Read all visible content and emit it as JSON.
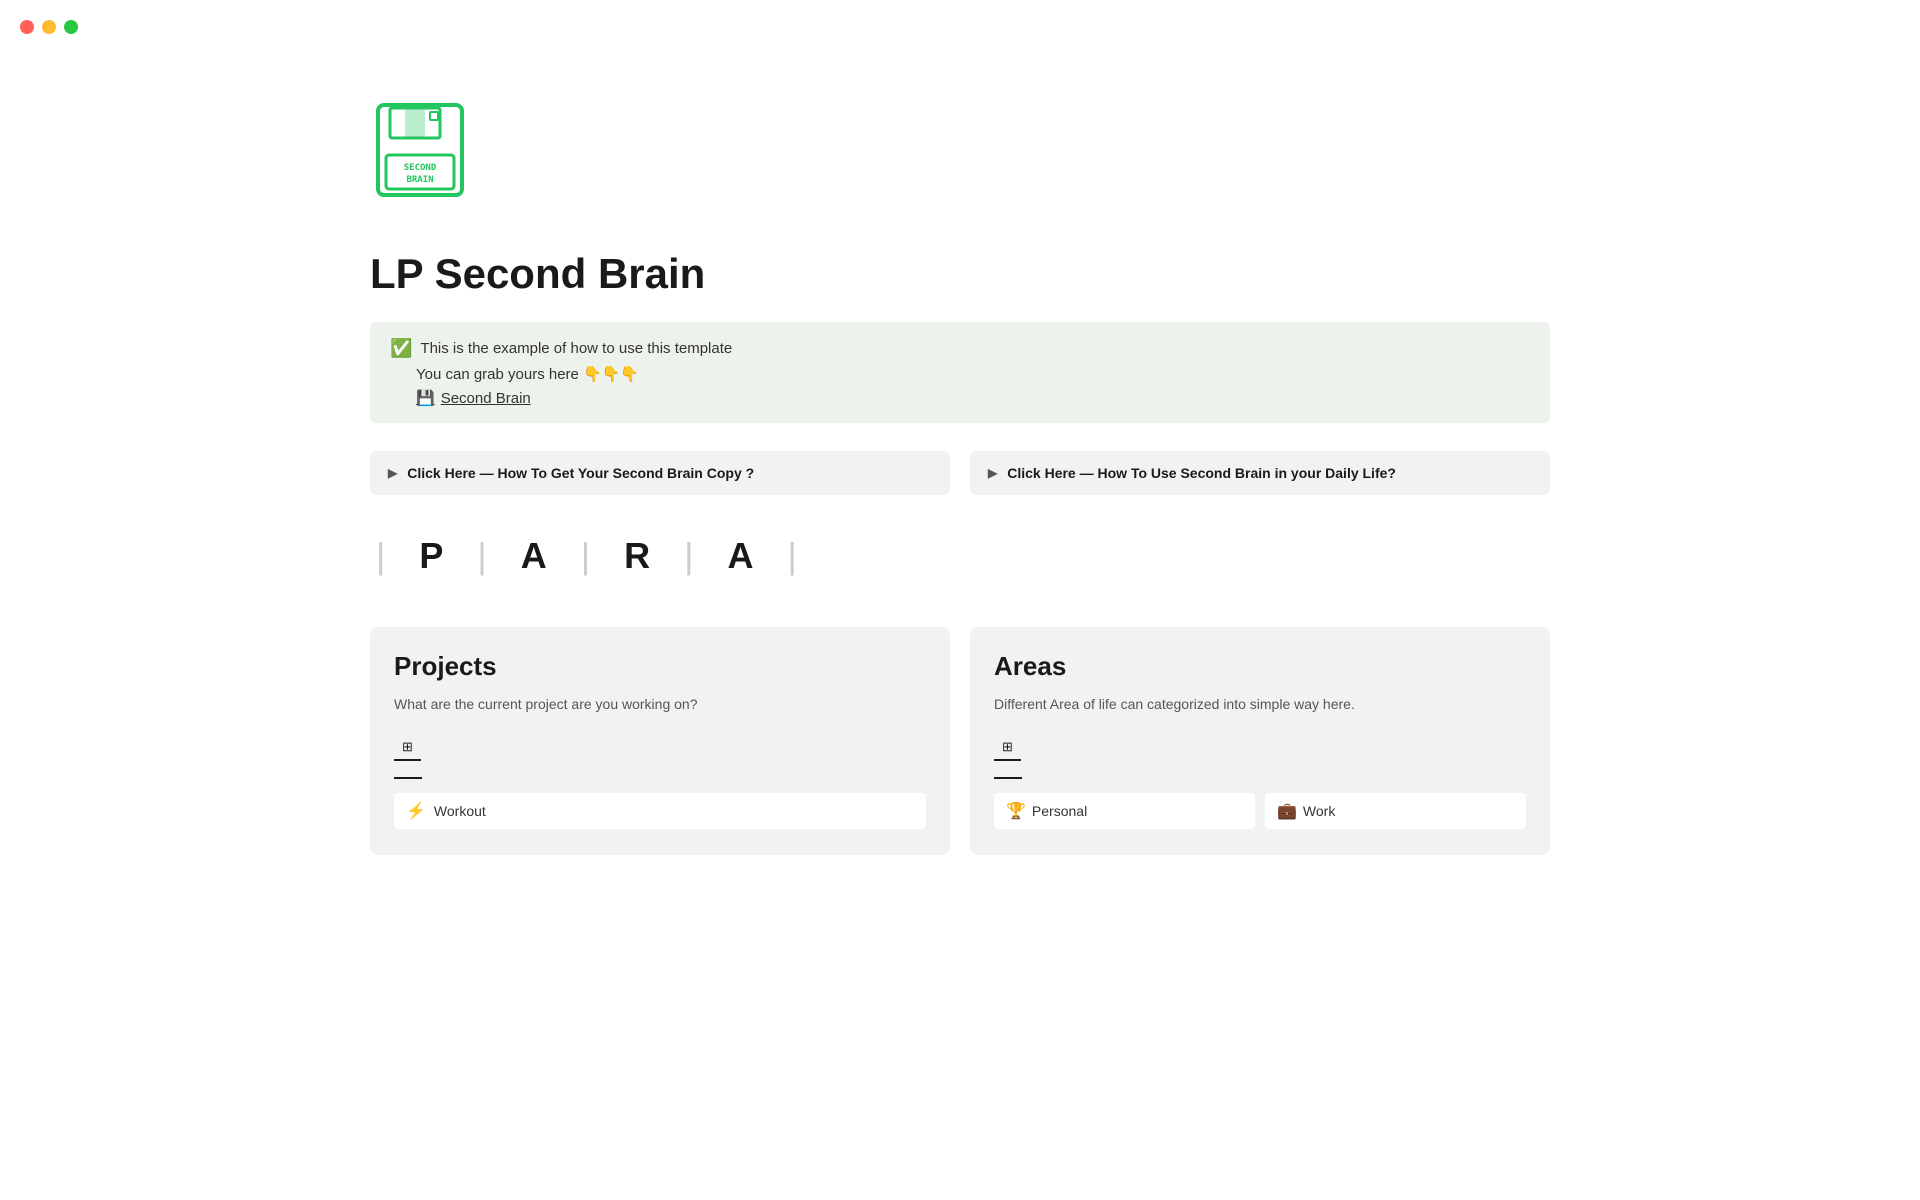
{
  "window": {
    "traffic_lights": {
      "red_label": "close",
      "yellow_label": "minimize",
      "green_label": "maximize"
    }
  },
  "page": {
    "icon_alt": "Second Brain floppy disk icon",
    "title": "LP Second Brain",
    "callout": {
      "line1": "This is the example of how to use this template",
      "line2": "You can grab yours here 👇👇👇",
      "link_label": "Second Brain"
    },
    "toggles": [
      {
        "label": "Click Here — How To Get Your Second Brain Copy ?"
      },
      {
        "label": "Click Here — How To Use Second Brain in your Daily Life?"
      }
    ],
    "para_heading": {
      "separator": "|",
      "letters": [
        "P",
        "A",
        "R",
        "A"
      ]
    },
    "sections": [
      {
        "id": "projects",
        "title": "Projects",
        "description": "What are the current project are you working on?",
        "items": [
          {
            "emoji": "⚡",
            "label": "Workout"
          }
        ]
      },
      {
        "id": "areas",
        "title": "Areas",
        "description": "Different Area of life can categorized into simple way here.",
        "items": [
          {
            "emoji": "🏆",
            "label": "Personal"
          },
          {
            "emoji": "💼",
            "label": "Work"
          }
        ]
      }
    ]
  }
}
